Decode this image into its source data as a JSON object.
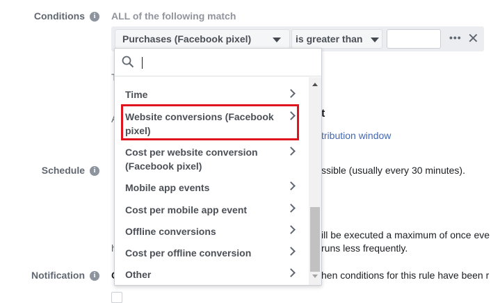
{
  "conditions": {
    "label": "Conditions",
    "match_text": "ALL of the following match",
    "metric_selected": "Purchases (Facebook pixel)",
    "operator_selected": "is greater than",
    "value": "",
    "more_text": "•••",
    "remove_text": "✕"
  },
  "schedule": {
    "label": "Schedule"
  },
  "notification": {
    "label": "Notification"
  },
  "background": {
    "attr_text": "t",
    "attr_link": "tribution window",
    "sched_text": "ssible (usually every 30 minutes).",
    "exec_text_1": "ill be executed a maximum of once eve",
    "exec_text_2": "runs less frequently.",
    "notif_text": "hen conditions for this rule have been r",
    "fragment_a": "A",
    "fragment_t": "T",
    "fragment_h": "h",
    "fragment_c": "C"
  },
  "dropdown": {
    "search_value": "",
    "items": [
      {
        "label": "Time"
      },
      {
        "label": "Website conversions (Facebook pixel)"
      },
      {
        "label": "Cost per website conversion (Facebook pixel)"
      },
      {
        "label": "Mobile app events"
      },
      {
        "label": "Cost per mobile app event"
      },
      {
        "label": "Offline conversions"
      },
      {
        "label": "Cost per offline conversion"
      },
      {
        "label": "Other"
      }
    ],
    "highlight_color": "#e0141e"
  },
  "icons": {
    "info": "info-icon",
    "search": "search-icon",
    "chevron": "chevron-right-icon",
    "caret": "caret-down-icon"
  },
  "colors": {
    "link": "#4267b2",
    "label": "#606770",
    "condition_bar": "#ebedf0"
  }
}
